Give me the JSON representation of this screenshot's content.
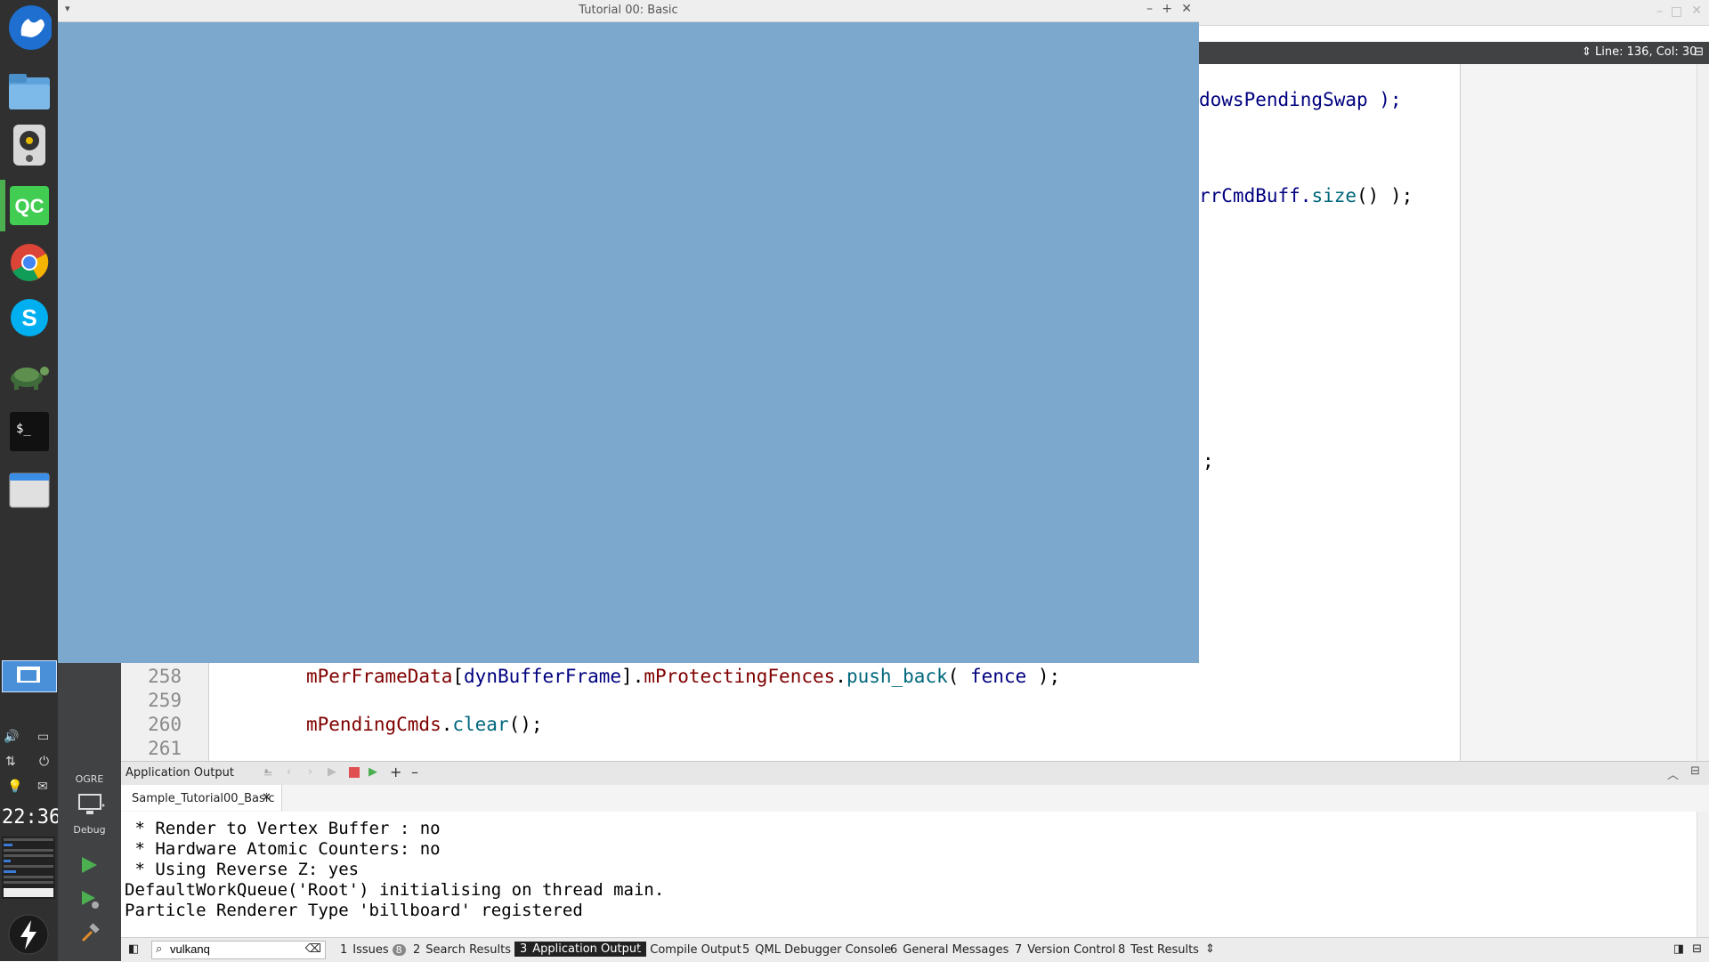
{
  "ogre_window": {
    "title": "Tutorial 00: Basic",
    "background": "#7ba8cc"
  },
  "editor": {
    "cursor_position": "Line: 136, Col: 30",
    "fragments": {
      "frag1": "dowsPendingSwap );",
      "frag2_a": "rrCmdBuff.",
      "frag2_b": "size",
      "frag2_c": "() );",
      "frag3": ";"
    },
    "lines": [
      {
        "number": "258",
        "parts": [
          {
            "text": "mPerFrameData",
            "color": "#800000"
          },
          {
            "text": "[",
            "color": "#000000"
          },
          {
            "text": "dynBufferFrame",
            "color": "#000080"
          },
          {
            "text": "].",
            "color": "#000000"
          },
          {
            "text": "mProtectingFences",
            "color": "#800000"
          },
          {
            "text": ".",
            "color": "#000000"
          },
          {
            "text": "push_back",
            "color": "#00677c"
          },
          {
            "text": "( ",
            "color": "#000000"
          },
          {
            "text": "fence",
            "color": "#000080"
          },
          {
            "text": " );",
            "color": "#000000"
          }
        ]
      },
      {
        "number": "259",
        "parts": []
      },
      {
        "number": "260",
        "parts": [
          {
            "text": "mPendingCmds",
            "color": "#800000"
          },
          {
            "text": ".",
            "color": "#000000"
          },
          {
            "text": "clear",
            "color": "#00677c"
          },
          {
            "text": "();",
            "color": "#000000"
          }
        ]
      },
      {
        "number": "261",
        "parts": []
      }
    ]
  },
  "modebar": {
    "project": "OGRE",
    "build_config": "Debug"
  },
  "dock": {
    "clock": "22:36"
  },
  "output": {
    "title": "Application Output",
    "tab": "Sample_Tutorial00_Basic",
    "lines": [
      " * Render to Vertex Buffer : no",
      " * Hardware Atomic Counters: no",
      " * Using Reverse Z: yes",
      "DefaultWorkQueue('Root') initialising on thread main.",
      "Particle Renderer Type 'billboard' registered"
    ]
  },
  "statusbar": {
    "search_value": "vulkanq",
    "panes": [
      {
        "num": "1",
        "label": "Issues",
        "badge": "8"
      },
      {
        "num": "2",
        "label": "Search Results"
      },
      {
        "num": "3",
        "label": "Application Output"
      },
      {
        "num": "4",
        "label": "Compile Output"
      },
      {
        "num": "5",
        "label": "QML Debugger Console"
      },
      {
        "num": "6",
        "label": "General Messages"
      },
      {
        "num": "7",
        "label": "Version Control"
      },
      {
        "num": "8",
        "label": "Test Results"
      }
    ]
  }
}
